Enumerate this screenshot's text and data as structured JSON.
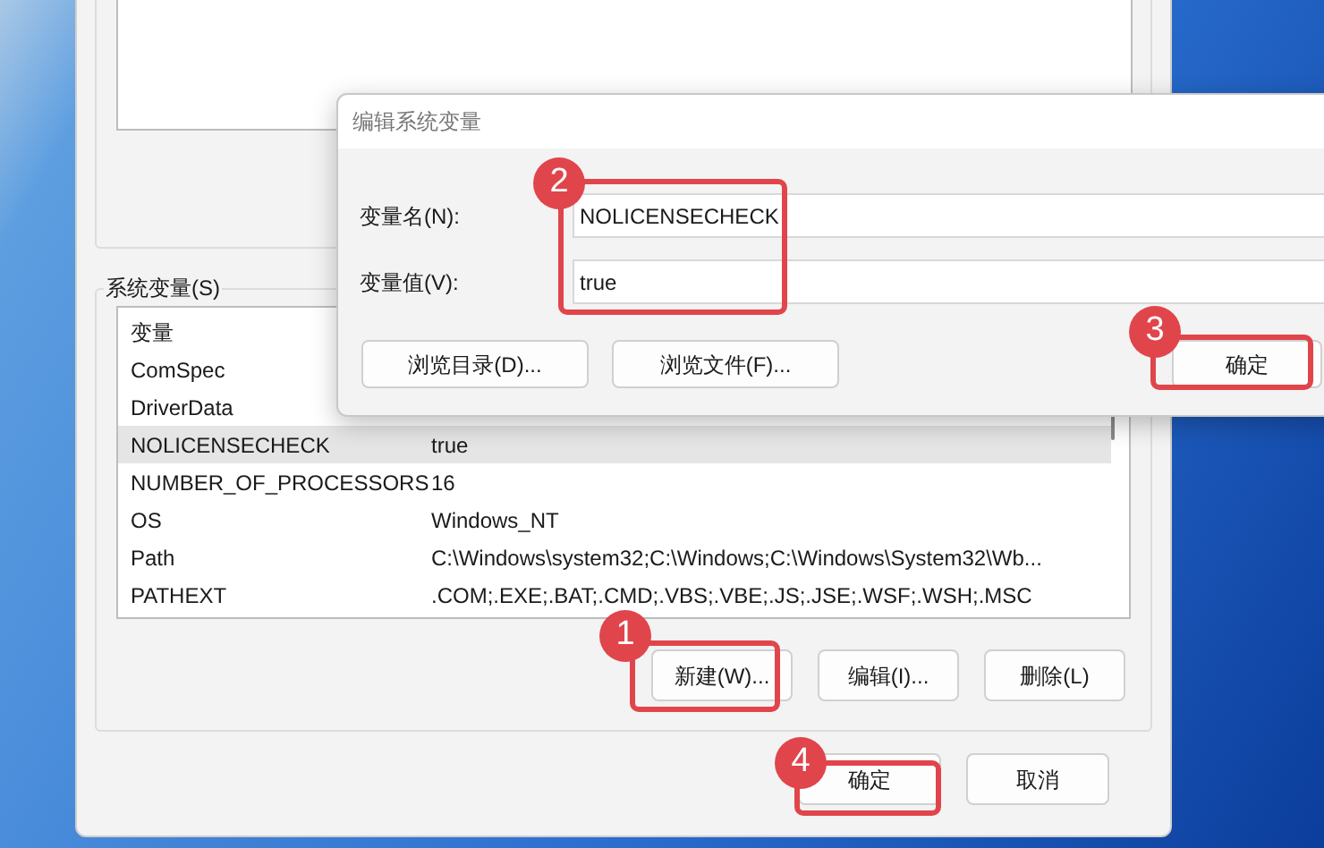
{
  "system_variables": {
    "label": "系统变量(S)",
    "columns": [
      "变量"
    ],
    "rows": [
      {
        "name": "ComSpec",
        "selected": false
      },
      {
        "name": "DriverData",
        "selected": false
      },
      {
        "name": "NOLICENSECHECK",
        "value": "true",
        "selected": true
      },
      {
        "name": "NUMBER_OF_PROCESSORS",
        "value": "16",
        "selected": false
      },
      {
        "name": "OS",
        "value": "Windows_NT",
        "selected": false
      },
      {
        "name": "Path",
        "value": "C:\\Windows\\system32;C:\\Windows;C:\\Windows\\System32\\Wb...",
        "selected": false
      },
      {
        "name": "PATHEXT",
        "value": ".COM;.EXE;.BAT;.CMD;.VBS;.VBE;.JS;.JSE;.WSF;.WSH;.MSC",
        "selected": false
      }
    ],
    "buttons": [
      "新建(W)...",
      "编辑(I)...",
      "删除(L)"
    ]
  },
  "window_buttons": [
    "确定",
    "取消"
  ],
  "edit_dialog": {
    "title": "编辑系统变量",
    "fields": [
      {
        "label": "变量名(N):",
        "value": "NOLICENSECHECK"
      },
      {
        "label": "变量值(V):",
        "value": "true"
      }
    ],
    "buttons": [
      "浏览目录(D)...",
      "浏览文件(F)..."
    ],
    "ok": "确定"
  },
  "annotations": [
    {
      "number": "1"
    },
    {
      "number": "2"
    },
    {
      "number": "3"
    },
    {
      "number": "4"
    }
  ]
}
